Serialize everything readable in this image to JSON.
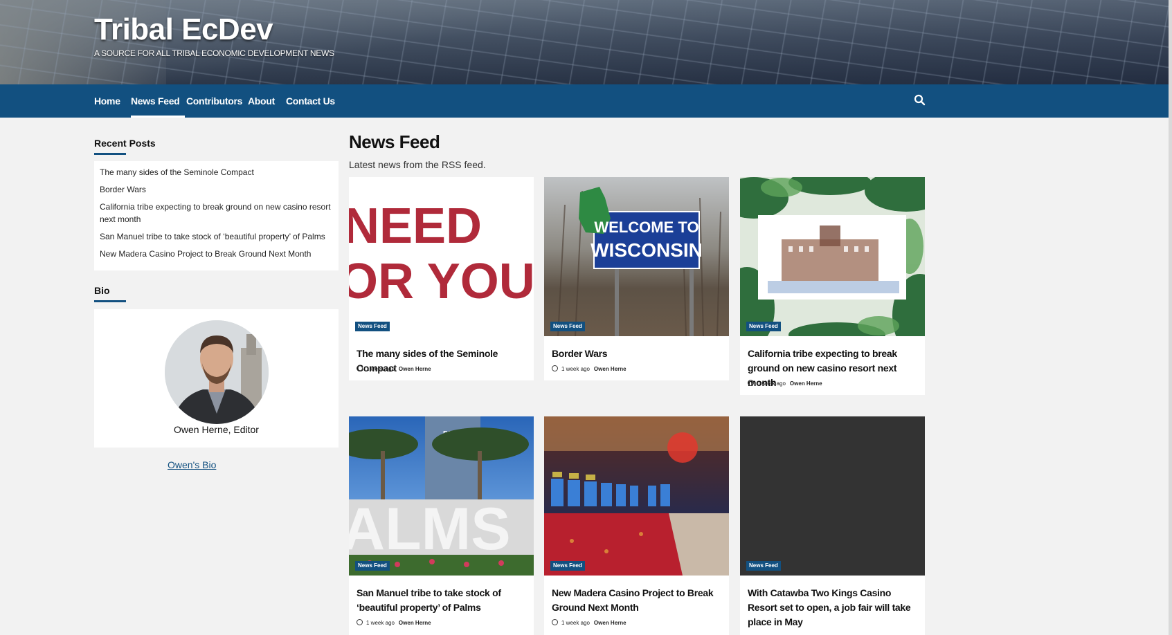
{
  "site": {
    "title": "Tribal EcDev",
    "tagline": "A SOURCE FOR ALL TRIBAL ECONOMIC DEVELOPMENT NEWS"
  },
  "nav": {
    "items": [
      {
        "label": "Home"
      },
      {
        "label": "News Feed",
        "active": true
      },
      {
        "label": "Contributors"
      },
      {
        "label": "About"
      },
      {
        "label": "Contact Us"
      }
    ],
    "search_icon": "search-icon"
  },
  "sidebar": {
    "recent_title": "Recent Posts",
    "recent_posts": [
      "The many sides of the Seminole Compact",
      "Border Wars",
      "California tribe expecting to break ground on new casino resort next month",
      "San Manuel tribe to take stock of ‘beautiful property’ of Palms",
      "New Madera Casino Project to Break Ground Next Month"
    ],
    "bio_title": "Bio",
    "bio_name": "Owen Herne, Editor",
    "bio_link": "Owen's Bio"
  },
  "main": {
    "title": "News Feed",
    "subtitle": "Latest news from the RSS feed.",
    "cards": [
      {
        "title": "The many sides of the Seminole Compact",
        "category": "News Feed",
        "ago": "1 week ago",
        "author": "Owen Herne",
        "image_text": [
          "NEED",
          "OR YOU"
        ]
      },
      {
        "title": "Border Wars",
        "category": "News Feed",
        "ago": "1 week ago",
        "author": "Owen Herne",
        "image_text": [
          "WELCOME TO",
          "WISCONSIN"
        ]
      },
      {
        "title": "California tribe expecting to break ground on new casino resort next month",
        "category": "News Feed",
        "ago": "1 week ago",
        "author": "Owen Herne"
      },
      {
        "title": "San Manuel tribe to take stock of ‘beautiful property’ of Palms",
        "category": "News Feed",
        "ago": "1 week ago",
        "author": "Owen Herne",
        "image_text": [
          "PALMS",
          "ALMS"
        ]
      },
      {
        "title": "New Madera Casino Project to Break Ground Next Month",
        "category": "News Feed",
        "ago": "1 week ago",
        "author": "Owen Herne"
      },
      {
        "title": "With Catawba Two Kings Casino Resort set to open, a job fair will take place in May",
        "category": "News Feed"
      }
    ]
  },
  "colors": {
    "nav_blue": "#125080",
    "background": "#f2f2f2"
  }
}
